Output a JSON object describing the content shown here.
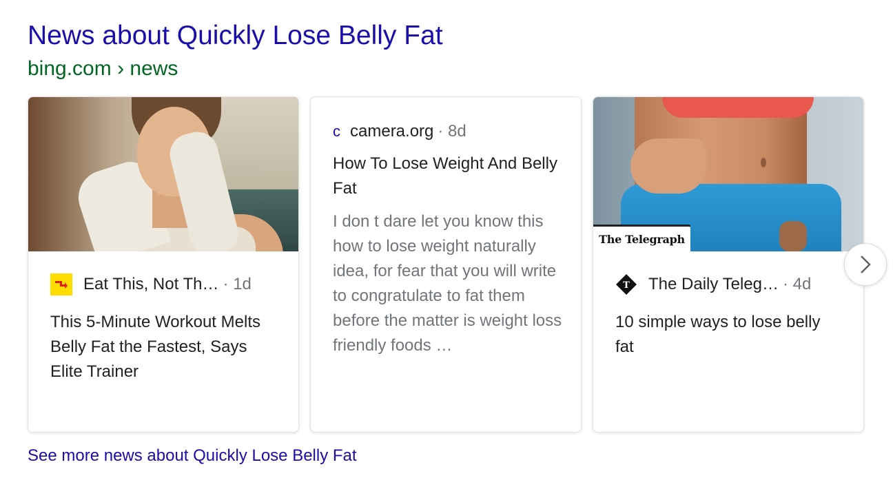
{
  "header": {
    "title": "News about Quickly Lose Belly Fat",
    "source": "bing.com › news"
  },
  "cards": [
    {
      "publisher": "Eat This, Not Th…",
      "age": "· 1d",
      "title": "This 5-Minute Workout Melts Belly Fat the Fastest, Says Elite Trainer",
      "logo_icon": "eat-this-logo-icon"
    },
    {
      "logo_letter": "c",
      "publisher": "camera.org",
      "age": "· 8d",
      "title": "How To Lose Weight And Belly Fat",
      "snippet": "I don t dare let you know this how to lose weight naturally idea, for fear that you will write to congratulate to fat them before the matter is weight loss friendly foods …"
    },
    {
      "badge": "The Telegraph",
      "publisher": "The Daily Teleg…",
      "age": "· 4d",
      "title": "10 simple ways to lose belly fat",
      "logo_icon": "telegraph-logo-icon"
    }
  ],
  "carousel": {
    "next_icon": "chevron-right-icon"
  },
  "footer": {
    "see_more": "See more news about Quickly Lose Belly Fat"
  },
  "colors": {
    "link": "#1a0dab",
    "url_green": "#006621",
    "muted": "#70757a",
    "eat_this_yellow": "#ffdd00",
    "eat_this_red": "#e0201b"
  }
}
